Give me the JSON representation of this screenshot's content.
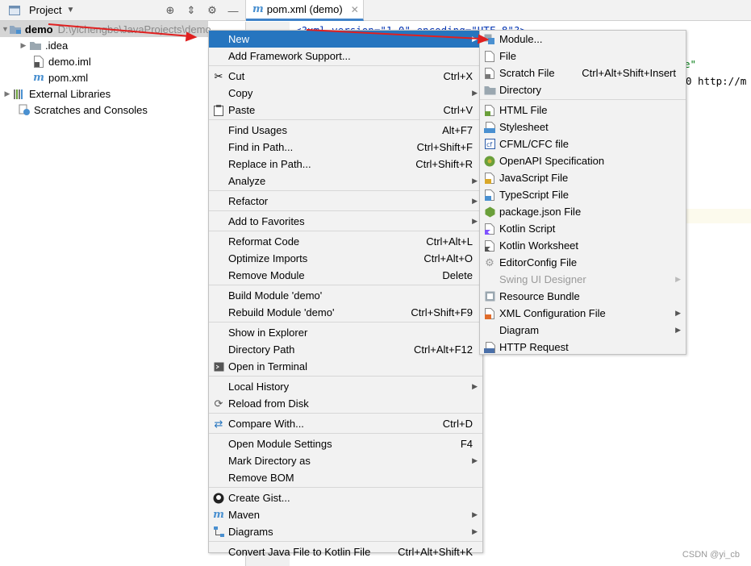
{
  "project_panel": {
    "title": "Project",
    "tree": [
      {
        "label": "demo",
        "path": "D:\\yichengbe\\JavaProjects\\demo"
      },
      {
        "label": ".idea"
      },
      {
        "label": "demo.iml"
      },
      {
        "label": "pom.xml"
      },
      {
        "label": "External Libraries"
      },
      {
        "label": "Scratches and Consoles"
      }
    ]
  },
  "editor": {
    "tab_label": "pom.xml (demo)",
    "tab_icon": "m",
    "code_line1": "<?xml version=\"1.0\" encoding=\"UTF-8\"?>",
    "code_fragment2": "e\"",
    "code_fragment3": "0 http://m"
  },
  "context_menu": {
    "items": [
      {
        "label": "New",
        "shortcut": ""
      },
      {
        "label": "Add Framework Support...",
        "shortcut": ""
      },
      {
        "label": "Cut",
        "shortcut": "Ctrl+X"
      },
      {
        "label": "Copy",
        "shortcut": ""
      },
      {
        "label": "Paste",
        "shortcut": "Ctrl+V"
      },
      {
        "label": "Find Usages",
        "shortcut": "Alt+F7"
      },
      {
        "label": "Find in Path...",
        "shortcut": "Ctrl+Shift+F"
      },
      {
        "label": "Replace in Path...",
        "shortcut": "Ctrl+Shift+R"
      },
      {
        "label": "Analyze",
        "shortcut": ""
      },
      {
        "label": "Refactor",
        "shortcut": ""
      },
      {
        "label": "Add to Favorites",
        "shortcut": ""
      },
      {
        "label": "Reformat Code",
        "shortcut": "Ctrl+Alt+L"
      },
      {
        "label": "Optimize Imports",
        "shortcut": "Ctrl+Alt+O"
      },
      {
        "label": "Remove Module",
        "shortcut": "Delete"
      },
      {
        "label": "Build Module 'demo'",
        "shortcut": ""
      },
      {
        "label": "Rebuild Module 'demo'",
        "shortcut": "Ctrl+Shift+F9"
      },
      {
        "label": "Show in Explorer",
        "shortcut": ""
      },
      {
        "label": "Directory Path",
        "shortcut": "Ctrl+Alt+F12"
      },
      {
        "label": "Open in Terminal",
        "shortcut": ""
      },
      {
        "label": "Local History",
        "shortcut": ""
      },
      {
        "label": "Reload from Disk",
        "shortcut": ""
      },
      {
        "label": "Compare With...",
        "shortcut": "Ctrl+D"
      },
      {
        "label": "Open Module Settings",
        "shortcut": "F4"
      },
      {
        "label": "Mark Directory as",
        "shortcut": ""
      },
      {
        "label": "Remove BOM",
        "shortcut": ""
      },
      {
        "label": "Create Gist...",
        "shortcut": ""
      },
      {
        "label": "Maven",
        "shortcut": ""
      },
      {
        "label": "Diagrams",
        "shortcut": ""
      },
      {
        "label": "Convert Java File to Kotlin File",
        "shortcut": "Ctrl+Alt+Shift+K"
      }
    ]
  },
  "submenu_new": {
    "items": [
      {
        "label": "Module...",
        "shortcut": ""
      },
      {
        "label": "File",
        "shortcut": ""
      },
      {
        "label": "Scratch File",
        "shortcut": "Ctrl+Alt+Shift+Insert"
      },
      {
        "label": "Directory",
        "shortcut": ""
      },
      {
        "label": "HTML File",
        "shortcut": ""
      },
      {
        "label": "Stylesheet",
        "shortcut": ""
      },
      {
        "label": "CFML/CFC file",
        "shortcut": ""
      },
      {
        "label": "OpenAPI Specification",
        "shortcut": ""
      },
      {
        "label": "JavaScript File",
        "shortcut": ""
      },
      {
        "label": "TypeScript File",
        "shortcut": ""
      },
      {
        "label": "package.json File",
        "shortcut": ""
      },
      {
        "label": "Kotlin Script",
        "shortcut": ""
      },
      {
        "label": "Kotlin Worksheet",
        "shortcut": ""
      },
      {
        "label": "EditorConfig File",
        "shortcut": ""
      },
      {
        "label": "Swing UI Designer",
        "shortcut": ""
      },
      {
        "label": "Resource Bundle",
        "shortcut": ""
      },
      {
        "label": "XML Configuration File",
        "shortcut": ""
      },
      {
        "label": "Diagram",
        "shortcut": ""
      },
      {
        "label": "HTTP Request",
        "shortcut": ""
      }
    ]
  },
  "watermark": "CSDN @yi_cb",
  "colors": {
    "menu_bg": "#f2f2f2",
    "selection": "#2675bf",
    "annotation_arrow": "#e02020"
  }
}
